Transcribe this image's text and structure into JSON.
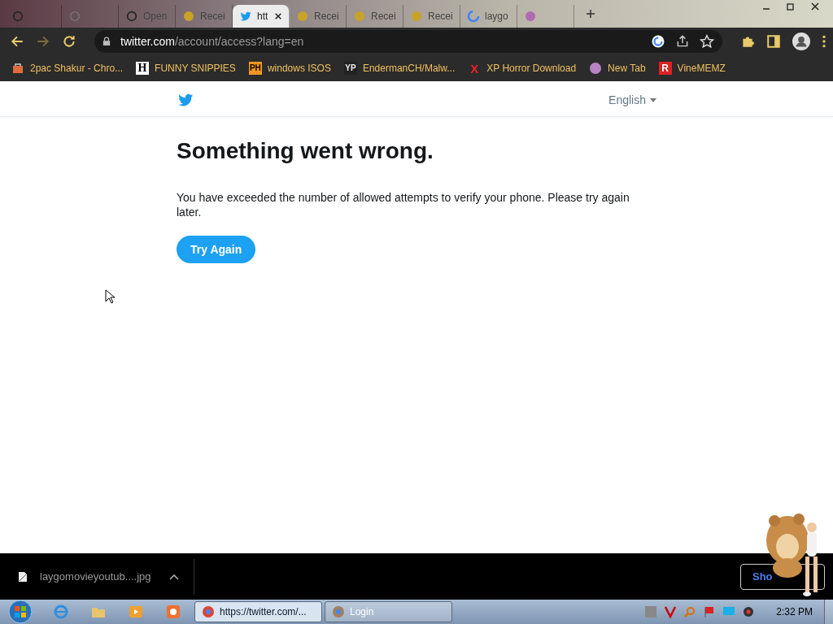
{
  "tabs": [
    {
      "selected": false
    },
    {
      "selected": false
    },
    {
      "title": "Open",
      "selected": false
    },
    {
      "title": "Recei",
      "selected": false
    },
    {
      "title": "htt",
      "selected": true
    },
    {
      "title": "Recei",
      "selected": false
    },
    {
      "title": "Recei",
      "selected": false
    },
    {
      "title": "Recei",
      "selected": false
    },
    {
      "title": "laygo",
      "selected": false
    },
    {
      "selected": false
    }
  ],
  "address": {
    "host": "twitter.com",
    "path": "/account/access?lang=en"
  },
  "bookmarks": [
    {
      "label": "2pac Shakur - Chro..."
    },
    {
      "label": "FUNNY SNIPPIES",
      "badge": "H"
    },
    {
      "label": "windows ISOS",
      "badge": "PH"
    },
    {
      "label": "EndermanCH/Malw...",
      "badge": "YP"
    },
    {
      "label": "XP Horror Download",
      "badge": "X"
    },
    {
      "label": "New Tab"
    },
    {
      "label": "VineMEMZ",
      "badge": "R"
    }
  ],
  "header": {
    "language": "English"
  },
  "error": {
    "title": "Something went wrong.",
    "message": "You have exceeded the number of allowed attempts to verify your phone. Please try again later.",
    "button": "Try Again"
  },
  "download": {
    "file": "laygomovieyoutub....jpg",
    "show_all": "Sho"
  },
  "taskbar": {
    "windows": [
      {
        "label": "https://twitter.com/...",
        "selected": true
      },
      {
        "label": "Login",
        "selected": false
      }
    ],
    "clock": "2:32 PM"
  }
}
